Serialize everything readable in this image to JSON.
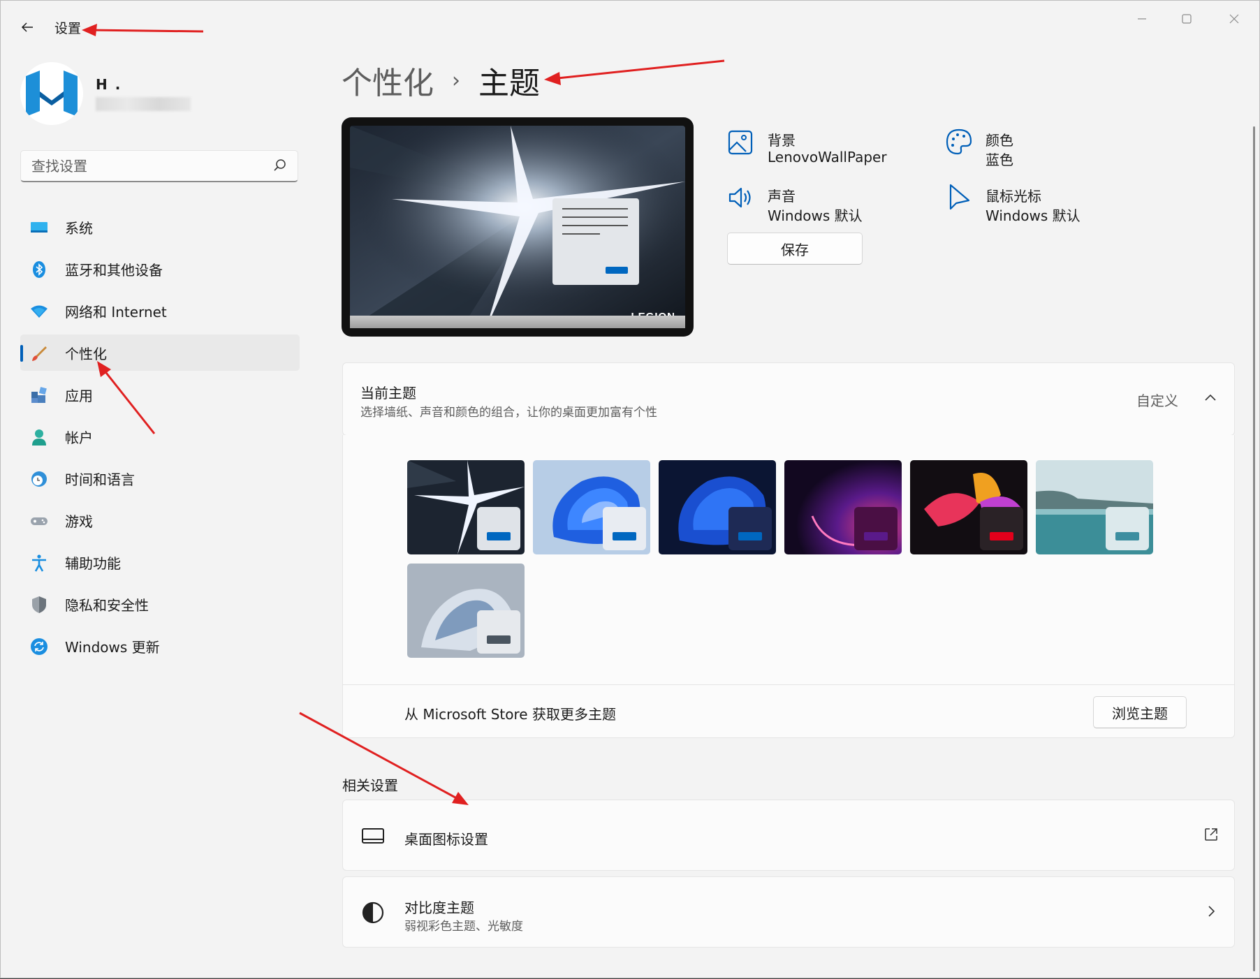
{
  "window": {
    "title": "设置",
    "controls": [
      "minimize",
      "maximize",
      "close"
    ]
  },
  "user": {
    "name": "H .",
    "avatar_letter": "M"
  },
  "search": {
    "placeholder": "查找设置"
  },
  "sidebar": {
    "items": [
      {
        "label": "系统",
        "icon": "system-icon",
        "active": false
      },
      {
        "label": "蓝牙和其他设备",
        "icon": "bluetooth-icon",
        "active": false
      },
      {
        "label": "网络和 Internet",
        "icon": "wifi-icon",
        "active": false
      },
      {
        "label": "个性化",
        "icon": "brush-icon",
        "active": true
      },
      {
        "label": "应用",
        "icon": "apps-icon",
        "active": false
      },
      {
        "label": "帐户",
        "icon": "account-icon",
        "active": false
      },
      {
        "label": "时间和语言",
        "icon": "time-language-icon",
        "active": false
      },
      {
        "label": "游戏",
        "icon": "gamepad-icon",
        "active": false
      },
      {
        "label": "辅助功能",
        "icon": "accessibility-icon",
        "active": false
      },
      {
        "label": "隐私和安全性",
        "icon": "shield-icon",
        "active": false
      },
      {
        "label": "Windows 更新",
        "icon": "update-icon",
        "active": false
      }
    ]
  },
  "breadcrumb": {
    "parent": "个性化",
    "separator": "›",
    "current": "主题"
  },
  "preview": {
    "brand_text": "LEGION"
  },
  "properties": {
    "background": {
      "name": "背景",
      "value": "LenovoWallPaper"
    },
    "color": {
      "name": "颜色",
      "value": "蓝色"
    },
    "sound": {
      "name": "声音",
      "value": "Windows 默认"
    },
    "cursor": {
      "name": "鼠标光标",
      "value": "Windows 默认"
    },
    "save_label": "保存"
  },
  "current_theme": {
    "title": "当前主题",
    "description": "选择墙纸、声音和颜色的组合，让你的桌面更加富有个性",
    "value": "自定义"
  },
  "themes": [
    {
      "name": "legion-theme",
      "mini_bg": "#dfe3e8",
      "button": "#0067c0"
    },
    {
      "name": "windows-light-theme",
      "mini_bg": "#e8ecf2",
      "button": "#0067c0"
    },
    {
      "name": "windows-dark-theme",
      "mini_bg": "#1e2a55",
      "button": "#0067c0"
    },
    {
      "name": "glow-theme",
      "mini_bg": "#4a0f44",
      "button": "#5a1a8a"
    },
    {
      "name": "captured-motion-theme",
      "mini_bg": "#2a2226",
      "button": "#e3001b"
    },
    {
      "name": "sunrise-theme",
      "mini_bg": "#dce9ec",
      "button": "#3c8ea0"
    },
    {
      "name": "flow-theme",
      "mini_bg": "#e6e9ed",
      "button": "#4a5560"
    }
  ],
  "store": {
    "text": "从 Microsoft Store 获取更多主题",
    "button": "浏览主题"
  },
  "related": {
    "title": "相关设置",
    "desktop_icons": {
      "title": "桌面图标设置"
    },
    "contrast": {
      "title": "对比度主题",
      "subtitle": "弱视彩色主题、光敏度"
    }
  },
  "colors": {
    "accent": "#005fb8",
    "annotation_arrow": "#e02020"
  }
}
